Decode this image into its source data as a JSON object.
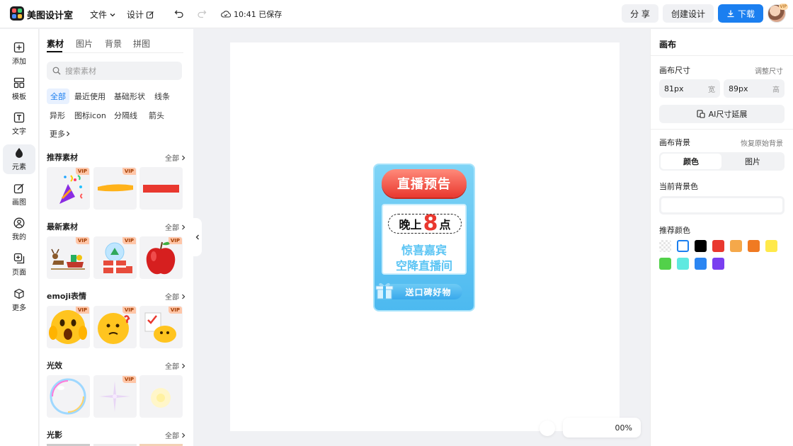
{
  "header": {
    "app_name": "美图设计室",
    "menu_file": "文件",
    "menu_design": "设计",
    "saved_status": "10:41 已保存",
    "share_label": "分 享",
    "create_label": "创建设计",
    "download_label": "下载",
    "avatar_badge": "VIP",
    "logo_colors": [
      "#ff5a5a",
      "#3fd27a",
      "#4a8cff",
      "#ffc23a"
    ]
  },
  "rail": {
    "items": [
      {
        "label": "添加",
        "icon": "plus-square-icon"
      },
      {
        "label": "模板",
        "icon": "template-icon"
      },
      {
        "label": "文字",
        "icon": "text-icon"
      },
      {
        "label": "元素",
        "icon": "shapes-icon"
      },
      {
        "label": "画图",
        "icon": "edit-icon"
      },
      {
        "label": "我的",
        "icon": "user-icon"
      },
      {
        "label": "页面",
        "icon": "page-icon"
      },
      {
        "label": "更多",
        "icon": "cube-icon"
      }
    ],
    "active": "元素"
  },
  "assets": {
    "tabs": [
      "素材",
      "图片",
      "背景",
      "拼图"
    ],
    "active_tab": "素材",
    "search_placeholder": "搜索素材",
    "chips": [
      "全部",
      "最近使用",
      "基础形状",
      "线条",
      "异形",
      "图标icon",
      "分隔线",
      "箭头",
      "更多"
    ],
    "active_chip": "全部",
    "vip_badge": "VIP",
    "all_label": "全部",
    "sections": [
      {
        "title": "推荐素材"
      },
      {
        "title": "最新素材"
      },
      {
        "title": "emoji表情"
      },
      {
        "title": "光效"
      },
      {
        "title": "光影"
      }
    ]
  },
  "canvas": {
    "poster": {
      "headline": "直播预告",
      "time_prefix": "晚上",
      "time_number": "8",
      "time_suffix": "点",
      "line1": "惊喜嘉宾",
      "line2": "空降直播间",
      "footer": "送口碑好物"
    },
    "zoom": "00%"
  },
  "right_panel": {
    "title": "画布",
    "size_label": "画布尺寸",
    "adjust_size": "调整尺寸",
    "width_value": "81px",
    "width_unit": "宽",
    "height_value": "89px",
    "height_unit": "高",
    "ai_extend": "AI尺寸延展",
    "bg_label": "画布背景",
    "restore_bg": "恢复原始背景",
    "seg_color": "颜色",
    "seg_image": "图片",
    "current_bg": "当前背景色",
    "recommend": "推荐颜色",
    "swatches": [
      "transparent",
      "#ffffff",
      "#000000",
      "#e9382f",
      "#f5a84a",
      "#f07a22",
      "#ffe94a",
      "#52d14a",
      "#5fe9e0",
      "#2c86f2",
      "#7a3ff0"
    ]
  }
}
